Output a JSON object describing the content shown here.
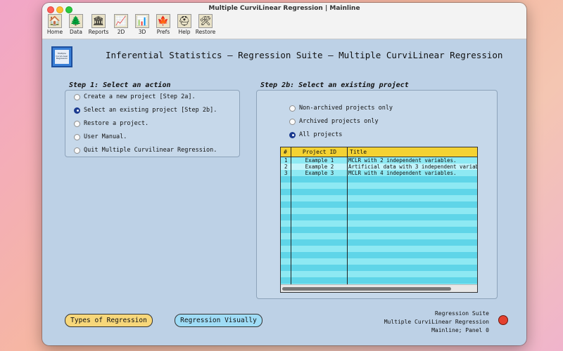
{
  "window": {
    "title": "Multiple CurviLinear Regression | Mainline"
  },
  "toolbar": {
    "items": [
      {
        "label": "Home",
        "icon": "home-icon"
      },
      {
        "label": "Data",
        "icon": "tree-icon"
      },
      {
        "label": "Reports",
        "icon": "building-icon"
      },
      {
        "label": "2D",
        "icon": "line-chart-icon"
      },
      {
        "label": "3D",
        "icon": "bar-chart-icon"
      },
      {
        "label": "Prefs",
        "icon": "leaf-icon"
      },
      {
        "label": "Help",
        "icon": "helmet-icon"
      },
      {
        "label": "Restore",
        "icon": "tools-icon"
      }
    ]
  },
  "logo": {
    "text": "Multiple CurviLinear Regression"
  },
  "page_title": "Inferential Statistics — Regression Suite — Multiple CurviLinear Regression",
  "step1": {
    "title": "Step 1: Select an action",
    "options": [
      {
        "label": "Create a new project [Step 2a].",
        "checked": false
      },
      {
        "label": "Select an existing project [Step 2b].",
        "checked": true
      },
      {
        "label": "Restore a project.",
        "checked": false
      },
      {
        "label": "User Manual.",
        "checked": false
      },
      {
        "label": "Quit Multiple Curvilinear Regression.",
        "checked": false
      }
    ]
  },
  "step2b": {
    "title": "Step 2b: Select an existing project",
    "filters": [
      {
        "label": "Non-archived projects only",
        "checked": false
      },
      {
        "label": "Archived projects only",
        "checked": false
      },
      {
        "label": "All projects",
        "checked": true
      }
    ]
  },
  "table": {
    "columns": [
      "#",
      "Project ID",
      "Title"
    ],
    "rows": [
      [
        "1",
        "Example 1",
        "MCLR with 2 independent variables."
      ],
      [
        "2",
        "Example 2",
        "Artificial data with 3 independent variab"
      ],
      [
        "3",
        "Example 3",
        "MCLR with 4 independent variables."
      ]
    ]
  },
  "buttons": {
    "types_of_regression": "Types of Regression",
    "regression_visually": "Regression Visually"
  },
  "status": {
    "line1": "Regression Suite",
    "line2": "Multiple CurviLinear Regression",
    "line3": "Mainline; Panel 0"
  },
  "colors": {
    "window_bg": "#bdd1e6",
    "table_header": "#f4d233",
    "row_light": "#8ee9f3",
    "row_dark": "#5fd5e8",
    "button_yellow": "#f7d77a",
    "button_blue": "#9fdcf6",
    "status_dot": "#e4412f"
  }
}
